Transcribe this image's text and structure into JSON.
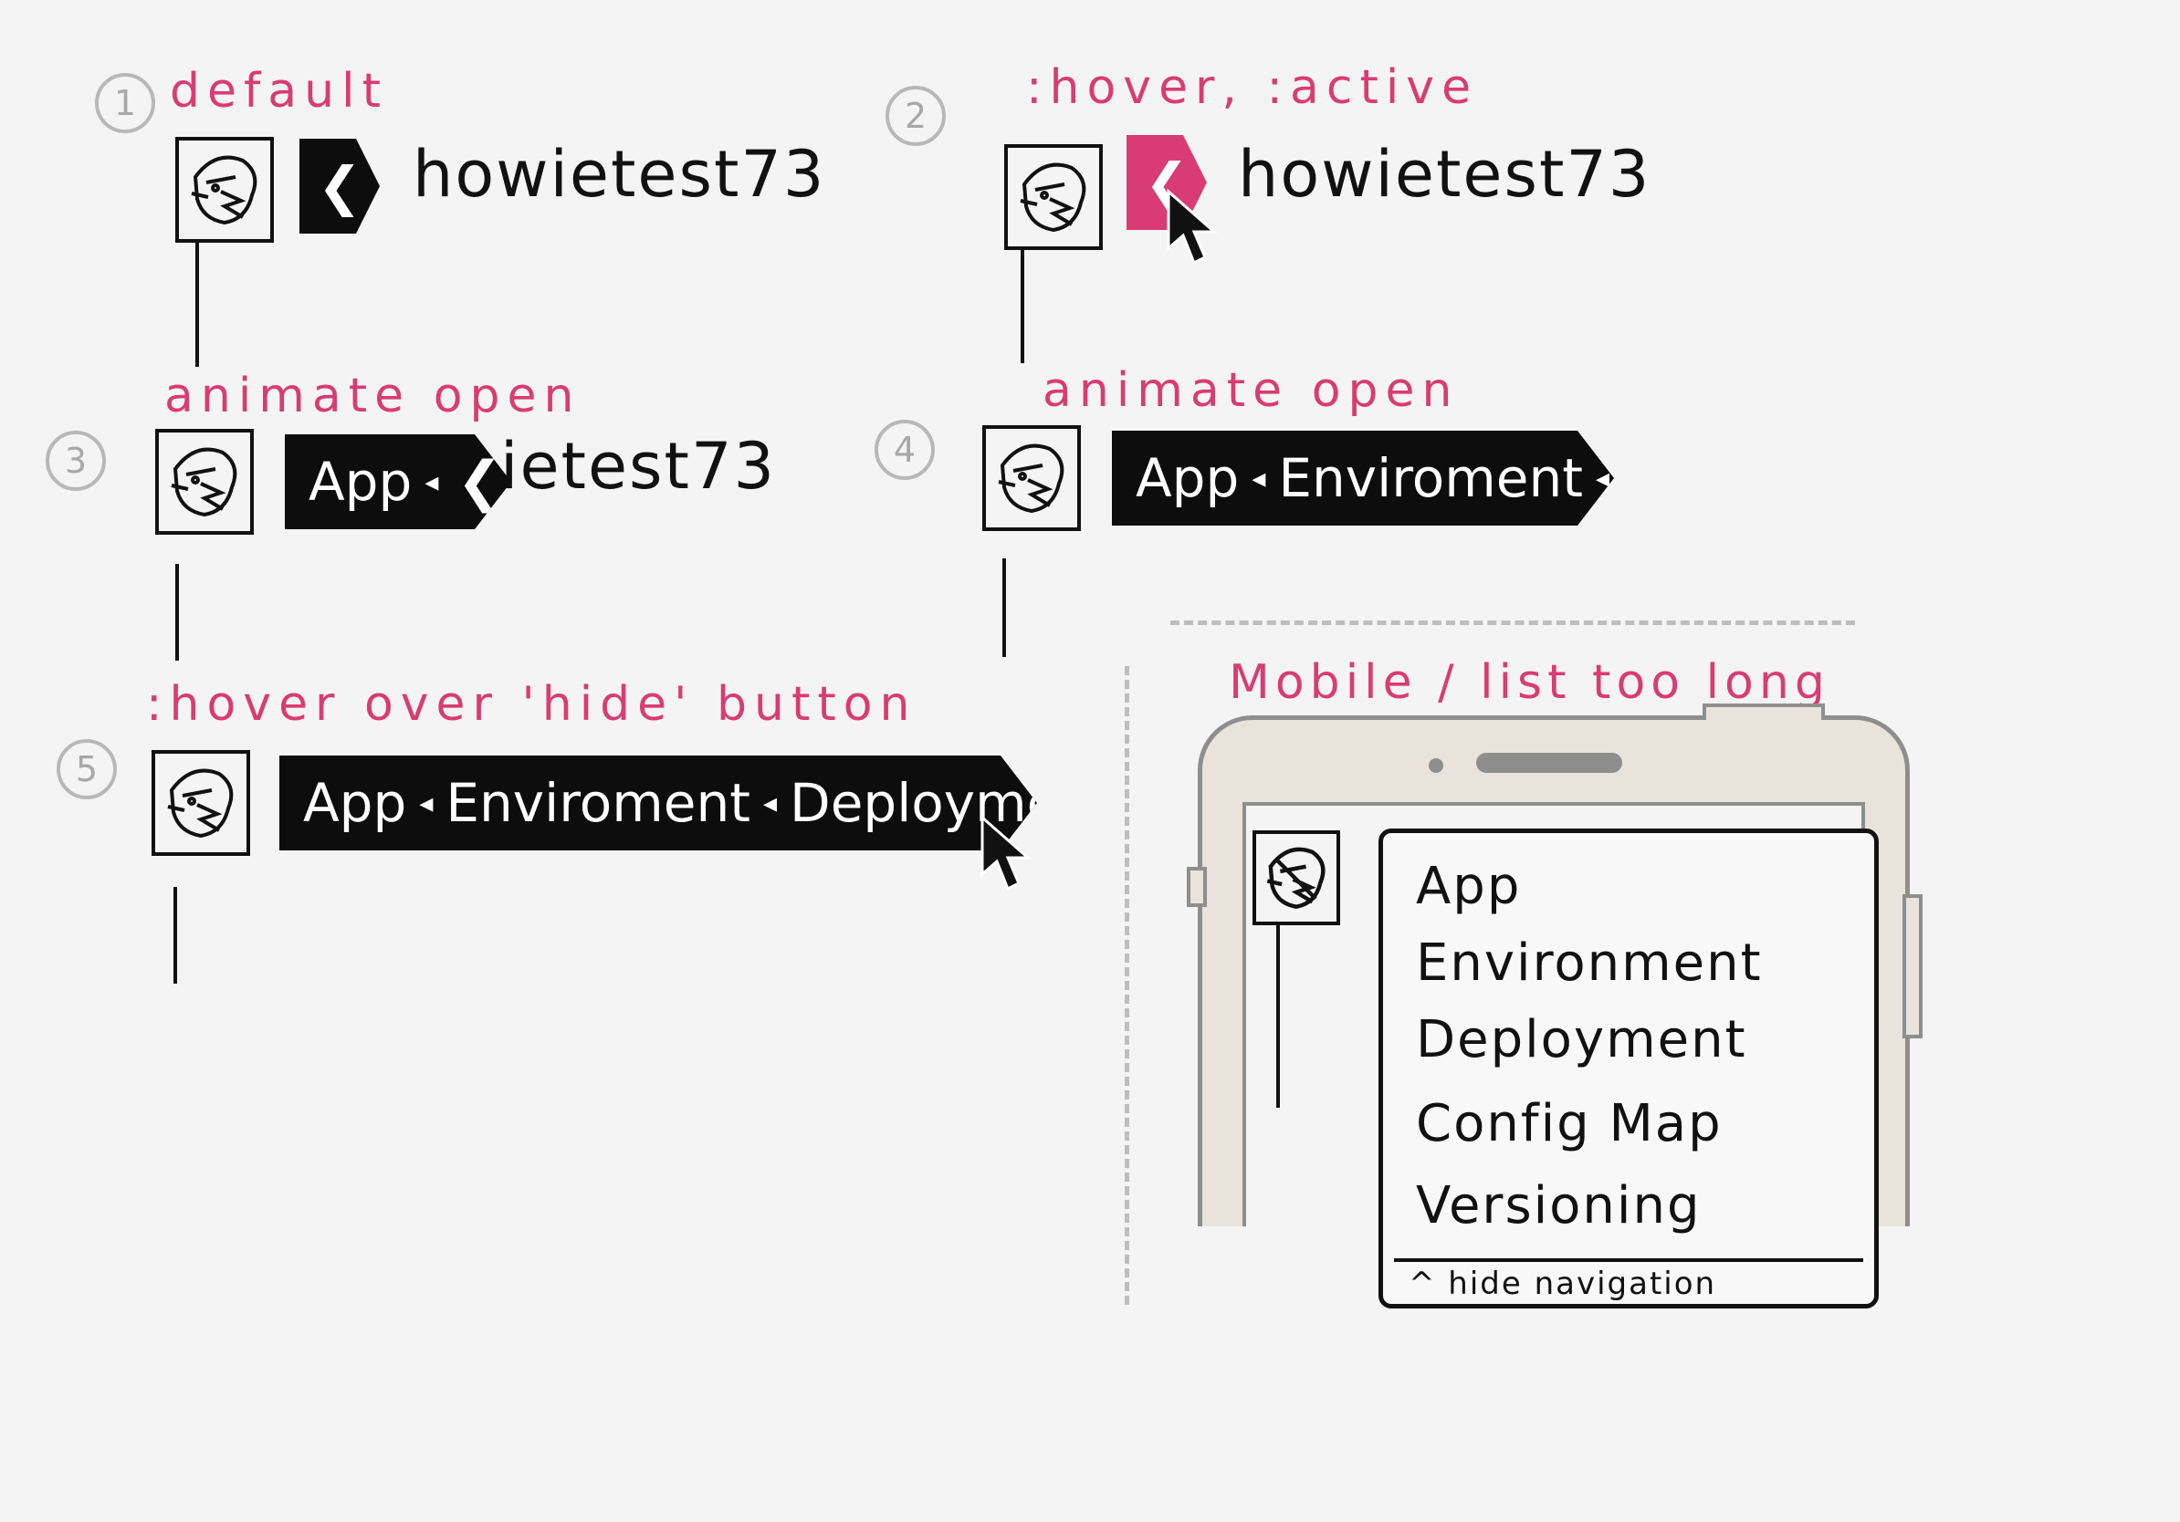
{
  "steps": [
    {
      "number": "1",
      "caption": "default"
    },
    {
      "number": "2",
      "caption": ":hover, :active"
    },
    {
      "number": "3",
      "caption": "animate open"
    },
    {
      "number": "4",
      "caption": "animate open"
    },
    {
      "number": "5",
      "caption": ":hover over 'hide' button"
    }
  ],
  "username": "howietest73",
  "username_partial": "ietest73",
  "breadcrumb": {
    "app": "App",
    "environment": "Enviroment",
    "deployment": "Deployment",
    "separator_glyph": "◂",
    "toggle_glyph": "❮"
  },
  "mobile": {
    "caption": "Mobile / list too long",
    "items": [
      "App",
      "Environment",
      "Deployment",
      "Config Map",
      "Versioning"
    ],
    "hide_label": "^ hide navigation"
  },
  "colors": {
    "accent": "#d83c72",
    "bar": "#0d0d0d",
    "phone_body": "#e9e3dc",
    "sketch_gray": "#b8b8b8"
  },
  "icons": [
    "avatar-icon",
    "chevron-left-icon",
    "cursor-icon",
    "triangle-separator-icon"
  ]
}
